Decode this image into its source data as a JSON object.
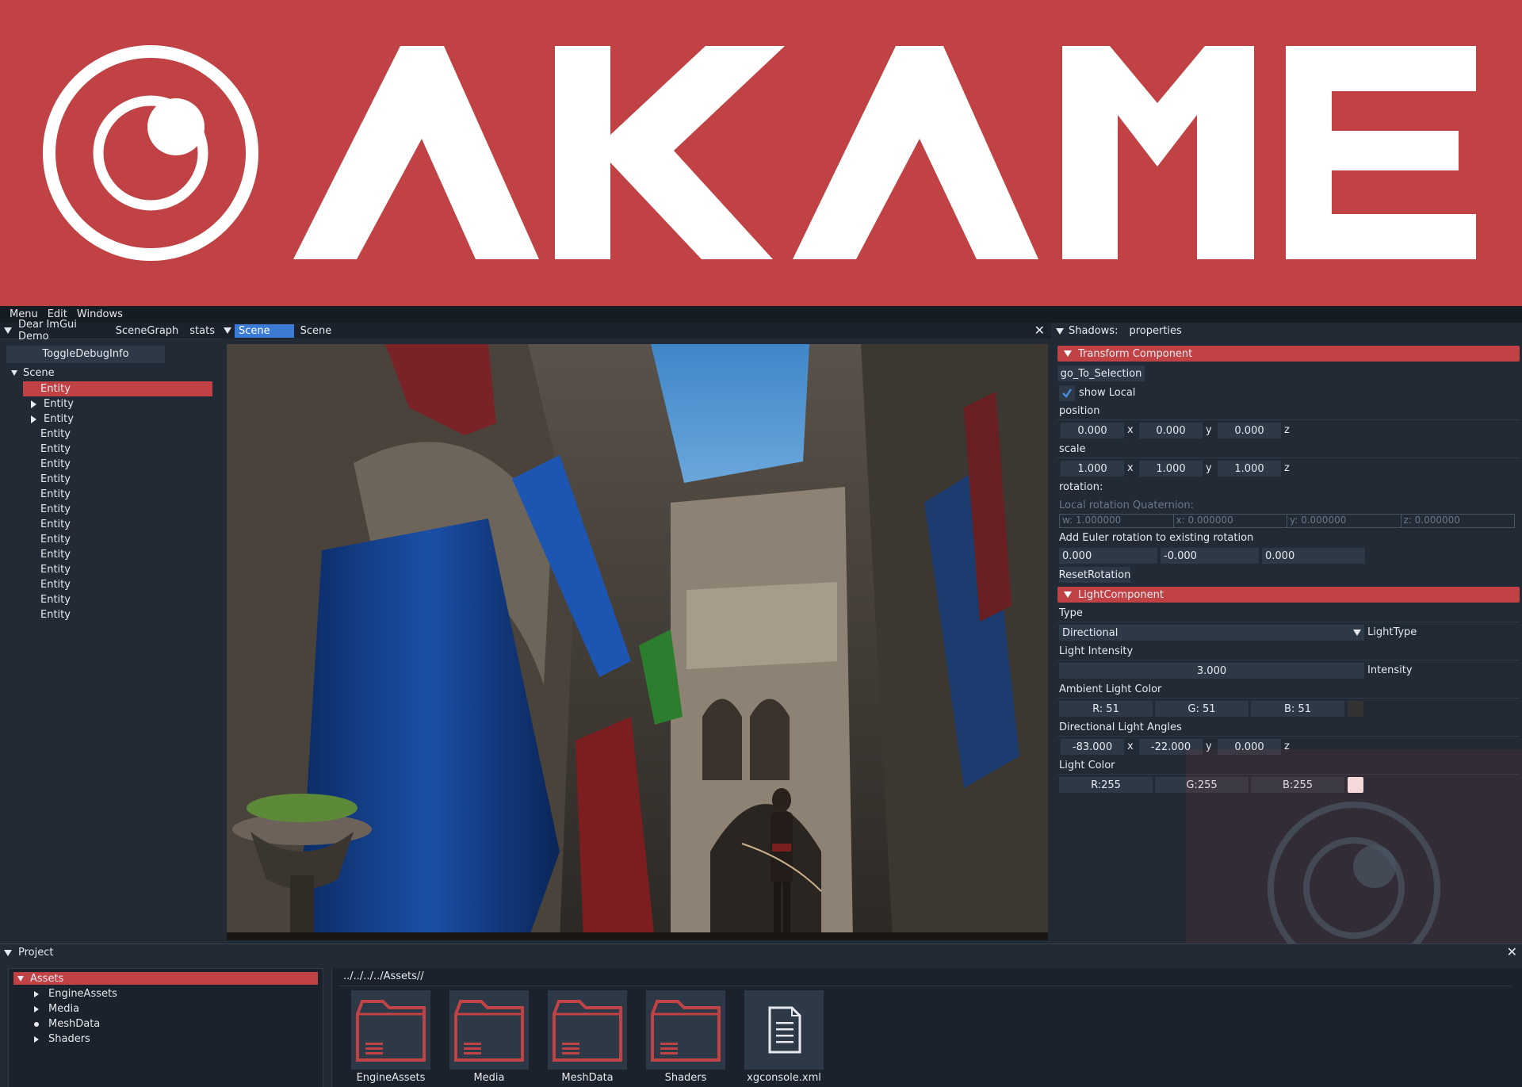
{
  "banner": {
    "title": "AKAME"
  },
  "menubar": {
    "items": [
      "Menu",
      "Edit",
      "Windows"
    ]
  },
  "left_panel": {
    "tabs": [
      "Dear ImGui Demo",
      "SceneGraph",
      "stats"
    ],
    "toggle_button": "ToggleDebugInfo",
    "root": "Scene",
    "entities": [
      {
        "label": "Entity",
        "expandable": false,
        "selected": true
      },
      {
        "label": "Entity",
        "expandable": true
      },
      {
        "label": "Entity",
        "expandable": true
      },
      {
        "label": "Entity"
      },
      {
        "label": "Entity"
      },
      {
        "label": "Entity"
      },
      {
        "label": "Entity"
      },
      {
        "label": "Entity"
      },
      {
        "label": "Entity"
      },
      {
        "label": "Entity"
      },
      {
        "label": "Entity"
      },
      {
        "label": "Entity"
      },
      {
        "label": "Entity"
      },
      {
        "label": "Entity"
      },
      {
        "label": "Entity"
      },
      {
        "label": "Entity"
      }
    ]
  },
  "viewport": {
    "tabs": [
      "Scene",
      "Scene"
    ],
    "close": "✕"
  },
  "properties": {
    "tabs": [
      "Shadows:",
      "properties"
    ],
    "transform": {
      "header": "Transform Component",
      "go_button": "go_To_Selection",
      "show_local": "show Local",
      "position_label": "position",
      "position": [
        "0.000",
        "0.000",
        "0.000"
      ],
      "scale_label": "scale",
      "scale": [
        "1.000",
        "1.000",
        "1.000"
      ],
      "axis": [
        "x",
        "y",
        "z"
      ],
      "rotation_label": "rotation:",
      "quat_label": "Local rotation Quaternion:",
      "quat": [
        "w: 1.000000",
        "x: 0.000000",
        "y: 0.000000",
        "z: 0.000000"
      ],
      "euler_label": "Add Euler rotation to existing rotation",
      "euler": [
        "0.000",
        "-0.000",
        "0.000"
      ],
      "reset_button": "ResetRotation"
    },
    "light": {
      "header": "LightComponent",
      "type_label": "Type",
      "type_value": "Directional",
      "type_suffix": "LightType",
      "intensity_label": "Light Intensity",
      "intensity_value": "3.000",
      "intensity_suffix": "Intensity",
      "ambient_label": "Ambient Light Color",
      "ambient": [
        "R: 51",
        "G: 51",
        "B: 51"
      ],
      "ambient_color": "#333333",
      "angles_label": "Directional Light Angles",
      "angles": [
        "-83.000",
        "-22.000",
        "0.000"
      ],
      "color_label": "Light Color",
      "color": [
        "R:255",
        "G:255",
        "B:255"
      ],
      "color_swatch": "#ffffff"
    }
  },
  "project": {
    "title": "Project",
    "tree_root": "Assets",
    "tree_children": [
      "EngineAssets",
      "Media",
      "MeshData",
      "Shaders"
    ],
    "path": "../../../../Assets//",
    "assets": [
      {
        "label": "EngineAssets",
        "kind": "folder"
      },
      {
        "label": "Media",
        "kind": "folder"
      },
      {
        "label": "MeshData",
        "kind": "folder"
      },
      {
        "label": "Shaders",
        "kind": "folder"
      },
      {
        "label": "xgconsole.xml",
        "kind": "file"
      }
    ]
  },
  "colors": {
    "accent": "#c04245",
    "panel": "#222a35",
    "field": "#2e3947",
    "tab_active": "#3b7bd5"
  }
}
